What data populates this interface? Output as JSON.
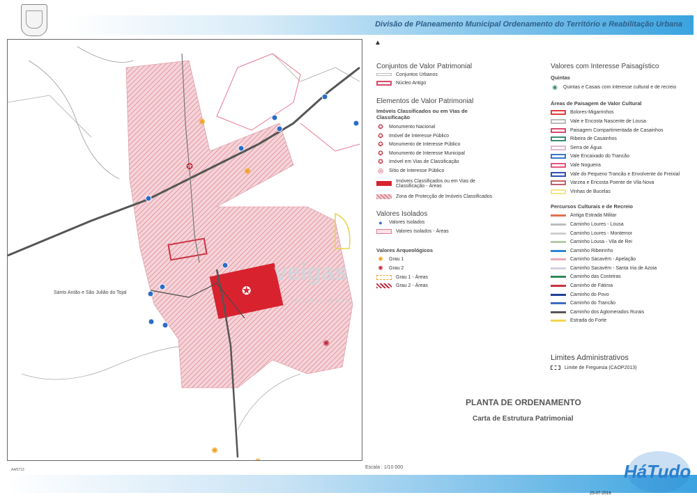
{
  "header": {
    "title": "Divisão de Planeamento Municipal Ordenamento do Território e Reabilitação Urbana"
  },
  "map": {
    "place_label": "Santo Antão e São Julião do Tojal",
    "code": "A4/0713",
    "scale": "Escala : 1/10 000",
    "date": "25-07-2016"
  },
  "plan": {
    "title": "PLANTA DE ORDENAMENTO",
    "subtitle": "Carta de Estrutura Patrimonial"
  },
  "watermark": {
    "brand": "veigas",
    "sub": "IMOBILIÁRIA",
    "site": "HáTudo"
  },
  "legend_left": {
    "conjuntos": {
      "title": "Conjuntos de Valor Patrimonial",
      "items": [
        "Conjuntos Urbanos",
        "Núcleo Antigo"
      ]
    },
    "elementos": {
      "title": "Elementos de Valor Patrimonial",
      "subtitle": "Imóveis Classificados ou em Vias de Classificação",
      "items": [
        "Monumento Nacional",
        "Imóvel de Interesse Público",
        "Monumento de Interesse Público",
        "Monumento de Interesse Municipal",
        "Imóvel em Vias de Classificação",
        "Sítio de Interesse Público"
      ],
      "areas": "Imóveis Classificados ou em Vias de Classificação - Áreas",
      "zona": "Zona de Protecção de Imóveis Classificados"
    },
    "isolados": {
      "title": "Valores Isolados",
      "items": [
        "Valores Isolados",
        "Valores Isolados - Áreas"
      ]
    },
    "arqueologicos": {
      "title": "Valores Arqueológicos",
      "items": [
        "Grau 1",
        "Grau 2",
        "Grau 1 - Áreas",
        "Grau 2 - Áreas"
      ]
    }
  },
  "legend_right": {
    "title": "Valores com Interesse Paisagístico",
    "quintas": {
      "title": "Quintas",
      "item": "Quintas e Casais com interesse cultural e de recreio"
    },
    "areas": {
      "title": "Áreas de Paisagem de Valor Cultural",
      "items": [
        {
          "label": "Bolores-Migarrinhos",
          "color": "#e23b3b"
        },
        {
          "label": "Vale e Encosta Nascente de Lousa",
          "color": "#b9b9b9"
        },
        {
          "label": "Paisagem Compartimentada de Casainhos",
          "color": "#d64b6a"
        },
        {
          "label": "Ribeira de Casainhos",
          "color": "#3b8c6e"
        },
        {
          "label": "Serra de Água",
          "color": "#dcb8d4"
        },
        {
          "label": "Vale Encaixado do Trancão",
          "color": "#3a77c7"
        },
        {
          "label": "Vale Nogueira",
          "color": "#e4587c"
        },
        {
          "label": "Vale do Pequeno Trancão e Envolvente do Freixial",
          "color": "#2f4fb0"
        },
        {
          "label": "Varzea e Encosta Poente de Vila Nova",
          "color": "#c0606a"
        },
        {
          "label": "Vinhas de Bucelas",
          "color": "#f4e58a"
        }
      ]
    },
    "percursos": {
      "title": "Percursos Culturais e de Recreio",
      "items": [
        {
          "label": "Antiga Estrada Militar",
          "color": "#e46f4c"
        },
        {
          "label": "Caminho Loures - Lousa",
          "color": "#bdbdbd"
        },
        {
          "label": "Caminho Loures - Montemor",
          "color": "#cfcfcf"
        },
        {
          "label": "Caminho Lousa - Vila de Rei",
          "color": "#b7c9a6"
        },
        {
          "label": "Caminho Ribeirinho",
          "color": "#2c84d6"
        },
        {
          "label": "Caminho Sacavém - Apelação",
          "color": "#e9a9b6"
        },
        {
          "label": "Caminho Sacavém - Santa Iria de Azoia",
          "color": "#d6cbe4"
        },
        {
          "label": "Caminho das Costeiras",
          "color": "#2e8b57"
        },
        {
          "label": "Caminho de Fátima",
          "color": "#c8333d"
        },
        {
          "label": "Caminho do Povo",
          "color": "#1f3f99"
        },
        {
          "label": "Caminho do Trancão",
          "color": "#3e6ec4"
        },
        {
          "label": "Caminho dos Aglomerados Rurais",
          "color": "#555555"
        },
        {
          "label": "Estrada do Forte",
          "color": "#f2d64a"
        }
      ]
    },
    "limites": {
      "title": "Limites Administrativos",
      "item": "Limite de Freguesia (CAOP2013)"
    }
  }
}
